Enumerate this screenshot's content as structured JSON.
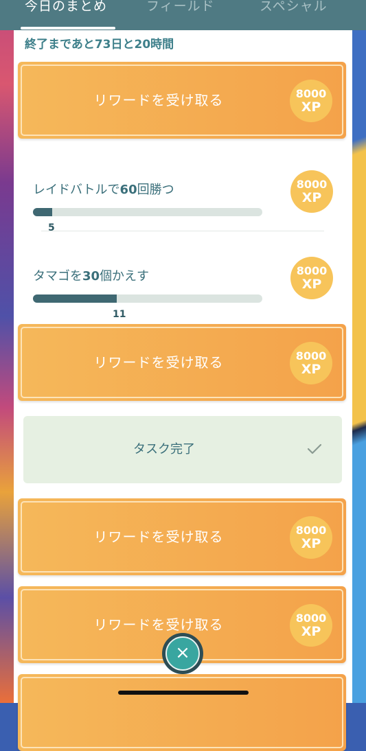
{
  "tabs": [
    {
      "label": "今日のまとめ",
      "active": true
    },
    {
      "label": "フィールド",
      "active": false
    },
    {
      "label": "スペシャル",
      "active": false
    }
  ],
  "countdown": "終了まであと73日と20時間",
  "xp": {
    "amount": "8000",
    "unit": "XP"
  },
  "reward_label": "リワードを受け取る",
  "tasks": [
    {
      "title_prefix": "レイドバトルで",
      "title_number": "60",
      "title_suffix": "回勝つ",
      "progress": 5,
      "goal": 60,
      "progress_label": "5"
    },
    {
      "title_prefix": "タマゴを",
      "title_number": "30",
      "title_suffix": "個かえす",
      "progress": 11,
      "goal": 30,
      "progress_label": "11"
    }
  ],
  "complete_label": "タスク完了",
  "icons": {
    "check": "check-icon",
    "close": "close-icon"
  },
  "colors": {
    "accent": "#f4a24a",
    "badge": "#f7c45a",
    "teal": "#3d7f8a",
    "tabbar": "#4f7a83"
  }
}
